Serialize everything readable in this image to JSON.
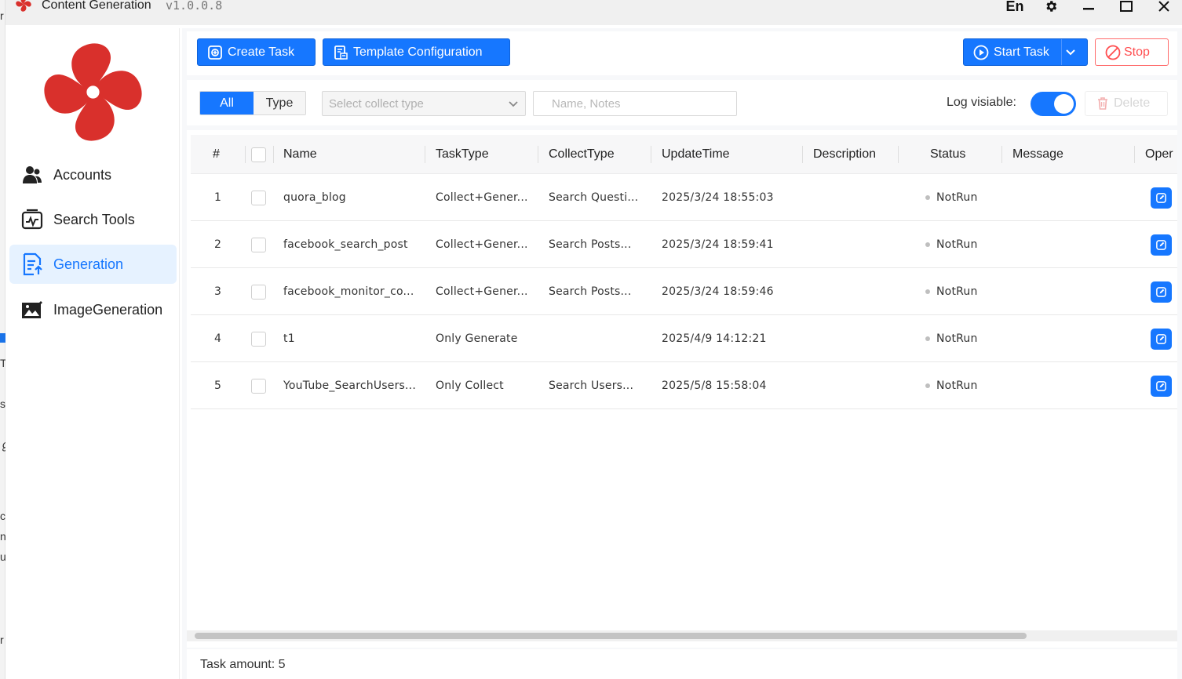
{
  "window": {
    "title": "Content Generation",
    "version": "v1.0.0.8",
    "controls": {
      "lang": "En"
    }
  },
  "sidebar": {
    "items": [
      {
        "label": "Accounts",
        "icon": "users-icon"
      },
      {
        "label": "Search Tools",
        "icon": "search-tools-icon"
      },
      {
        "label": "Generation",
        "icon": "generation-icon",
        "active": true
      },
      {
        "label": "ImageGeneration",
        "icon": "image-generation-icon"
      }
    ]
  },
  "toolbar": {
    "create_task": "Create Task",
    "template_config": "Template Configuration",
    "start_task": "Start Task",
    "stop": "Stop"
  },
  "filters": {
    "all": "All",
    "type": "Type",
    "collect_type_placeholder": "Select collect type",
    "search_placeholder": "Name, Notes",
    "log_visible_label": "Log visiable:",
    "log_visible": true,
    "delete": "Delete"
  },
  "table": {
    "columns": [
      "#",
      "Name",
      "TaskType",
      "CollectType",
      "UpdateTime",
      "Description",
      "Status",
      "Message",
      "Oper"
    ],
    "rows": [
      {
        "index": "1",
        "name": "quora_blog",
        "task_type": "Collect+Gener...",
        "collect_type": "Search Questi...",
        "update_time": "2025/3/24 18:55:03",
        "description": "",
        "status": "NotRun",
        "message": ""
      },
      {
        "index": "2",
        "name": "facebook_search_post",
        "task_type": "Collect+Gener...",
        "collect_type": "Search Posts...",
        "update_time": "2025/3/24 18:59:41",
        "description": "",
        "status": "NotRun",
        "message": ""
      },
      {
        "index": "3",
        "name": "facebook_monitor_co...",
        "task_type": "Collect+Gener...",
        "collect_type": "Search Posts...",
        "update_time": "2025/3/24 18:59:46",
        "description": "",
        "status": "NotRun",
        "message": ""
      },
      {
        "index": "4",
        "name": "t1",
        "task_type": "Only Generate",
        "collect_type": "",
        "update_time": "2025/4/9 14:12:21",
        "description": "",
        "status": "NotRun",
        "message": ""
      },
      {
        "index": "5",
        "name": "YouTube_SearchUsers...",
        "task_type": "Only Collect",
        "collect_type": "Search Users...",
        "update_time": "2025/5/8 15:58:04",
        "description": "",
        "status": "NotRun",
        "message": ""
      }
    ]
  },
  "footer": {
    "task_amount": "Task amount: 5"
  },
  "colors": {
    "accent": "#1677ff",
    "danger": "#ff4d4f",
    "logo": "#d9302c"
  }
}
